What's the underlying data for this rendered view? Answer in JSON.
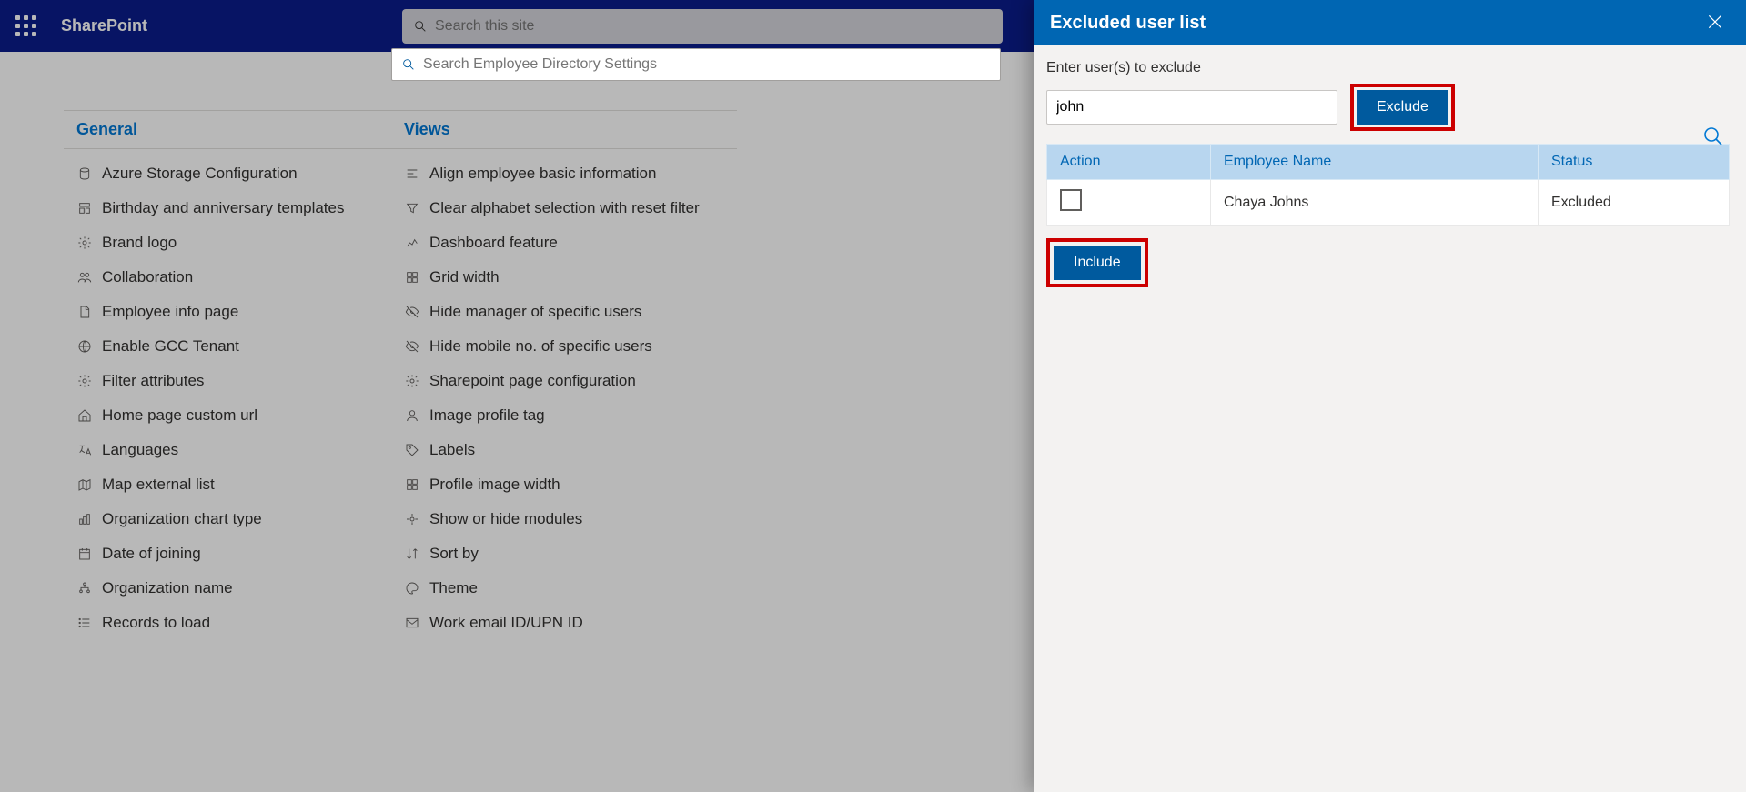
{
  "suite": {
    "title": "SharePoint",
    "search_placeholder": "Search this site"
  },
  "settings_search_placeholder": "Search Employee Directory Settings",
  "columns": {
    "general": {
      "header": "General",
      "items": [
        "Azure Storage Configuration",
        "Birthday and anniversary templates",
        "Brand logo",
        "Collaboration",
        "Employee info page",
        "Enable GCC Tenant",
        "Filter attributes",
        "Home page custom url",
        "Languages",
        "Map external list",
        "Organization chart type",
        "Date of joining",
        "Organization name",
        "Records to load"
      ]
    },
    "views": {
      "header": "Views",
      "items": [
        "Align employee basic information",
        "Clear alphabet selection with reset filter",
        "Dashboard feature",
        "Grid width",
        "Hide manager of specific users",
        "Hide mobile no. of specific users",
        "Sharepoint page configuration",
        "Image profile tag",
        "Labels",
        "Profile image width",
        "Show or hide modules",
        "Sort by",
        "Theme",
        "Work email ID/UPN ID"
      ]
    }
  },
  "panel": {
    "title": "Excluded user list",
    "label": "Enter user(s) to exclude",
    "input_value": "john",
    "exclude_btn": "Exclude",
    "include_btn": "Include",
    "table": {
      "col_action": "Action",
      "col_name": "Employee Name",
      "col_status": "Status",
      "rows": [
        {
          "name": "Chaya Johns",
          "status": "Excluded"
        }
      ]
    }
  }
}
